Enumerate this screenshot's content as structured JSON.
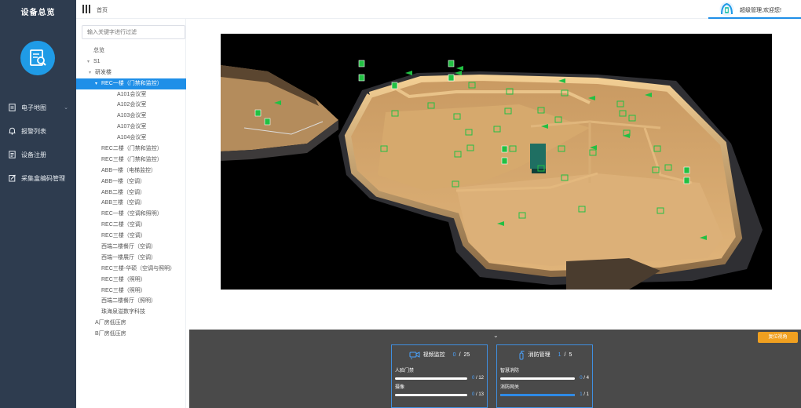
{
  "sidebar": {
    "title": "设备总览",
    "logo_icon": "monitor-search-icon",
    "menu": [
      {
        "label": "电子地图",
        "icon": "map-doc-icon",
        "has_children": true
      },
      {
        "label": "报警列表",
        "icon": "bell-icon",
        "has_children": false
      },
      {
        "label": "设备注册",
        "icon": "register-doc-icon",
        "has_children": false
      },
      {
        "label": "采集盒编码管理",
        "icon": "edit-icon",
        "has_children": false
      }
    ]
  },
  "header": {
    "breadcrumb": "首页",
    "welcome": "超级管理,欢迎您!",
    "accent": "#1f8fe8"
  },
  "tree": {
    "search_placeholder": "输入关键字进行过滤",
    "nodes": [
      {
        "label": "总览",
        "level": 0,
        "arrow": ""
      },
      {
        "label": "S1",
        "level": 0,
        "arrow": "▾"
      },
      {
        "label": "研发楼",
        "level": 1,
        "arrow": "▾"
      },
      {
        "label": "REC一楼（门禁和监控）",
        "level": 2,
        "arrow": "▾",
        "selected": true
      },
      {
        "label": "A101会议室",
        "level": 3,
        "arrow": ""
      },
      {
        "label": "A102会议室",
        "level": 3,
        "arrow": ""
      },
      {
        "label": "A103会议室",
        "level": 3,
        "arrow": ""
      },
      {
        "label": "A107会议室",
        "level": 3,
        "arrow": ""
      },
      {
        "label": "A104会议室",
        "level": 3,
        "arrow": ""
      },
      {
        "label": "REC二楼（门禁和监控）",
        "level": 2,
        "arrow": ""
      },
      {
        "label": "REC三楼（门禁和监控）",
        "level": 2,
        "arrow": ""
      },
      {
        "label": "ABB一楼（电梯监控）",
        "level": 2,
        "arrow": ""
      },
      {
        "label": "ABB一楼（空调）",
        "level": 2,
        "arrow": ""
      },
      {
        "label": "ABB二楼（空调）",
        "level": 2,
        "arrow": ""
      },
      {
        "label": "ABB三楼（空调）",
        "level": 2,
        "arrow": ""
      },
      {
        "label": "REC一楼（空调和照明）",
        "level": 2,
        "arrow": ""
      },
      {
        "label": "REC二楼（空调）",
        "level": 2,
        "arrow": ""
      },
      {
        "label": "REC三楼（空调）",
        "level": 2,
        "arrow": ""
      },
      {
        "label": "西端二楼餐厅（空调）",
        "level": 2,
        "arrow": ""
      },
      {
        "label": "西端一楼展厅（空调）",
        "level": 2,
        "arrow": ""
      },
      {
        "label": "REC三楼-华硕（空调与照明）",
        "level": 2,
        "arrow": ""
      },
      {
        "label": "REC三楼（照明）",
        "level": 2,
        "arrow": ""
      },
      {
        "label": "REC三楼（照明）",
        "level": 2,
        "arrow": ""
      },
      {
        "label": "西端二楼餐厅（照明）",
        "level": 2,
        "arrow": ""
      },
      {
        "label": "珠海泉溢数字科技",
        "level": 2,
        "arrow": ""
      },
      {
        "label": "A厂房低压房",
        "level": 1,
        "arrow": ""
      },
      {
        "label": "B厂房低压房",
        "level": 1,
        "arrow": ""
      }
    ]
  },
  "viewer": {
    "markers": {
      "camera_count": 12,
      "door_count": 11,
      "fire_count": 30,
      "marker_color": "#22c043"
    }
  },
  "bottom": {
    "collapse_icon": "chevron-down-icon",
    "reset_label": "复位视角",
    "cards": [
      {
        "icon": "video-camera-icon",
        "title": "视频监控",
        "count": "0",
        "total": "25",
        "rows": [
          {
            "label": "人脸门禁",
            "value": "0",
            "total": "12",
            "fill": 0
          },
          {
            "label": "摄像",
            "value": "0",
            "total": "13",
            "fill": 0
          }
        ]
      },
      {
        "icon": "fire-extinguisher-icon",
        "title": "消防管理",
        "count": "1",
        "total": "5",
        "rows": [
          {
            "label": "智慧消防",
            "value": "0",
            "total": "4",
            "fill": 0
          },
          {
            "label": "消防网关",
            "value": "1",
            "total": "1",
            "fill": 1
          }
        ]
      }
    ]
  }
}
